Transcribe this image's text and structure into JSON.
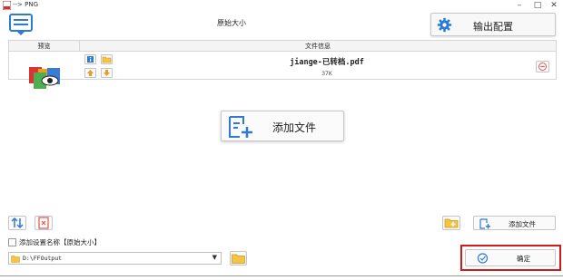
{
  "window": {
    "title": "--> PNG"
  },
  "toolbar": {
    "size_label": "原始大小",
    "output_config_label": "输出配置"
  },
  "table": {
    "headers": {
      "preview": "预览",
      "info": "文件信息"
    },
    "rows": [
      {
        "filename": "jiange-已转档.pdf",
        "size": "37K"
      }
    ]
  },
  "center": {
    "add_file_label": "添加文件"
  },
  "bottom": {
    "add_file_label": "添加文件",
    "checkbox_label": "添加设置名称【原始大小】",
    "checkbox_checked": false,
    "output_path": "D:\\FFOutput",
    "confirm_label": "确定"
  },
  "colors": {
    "accent_blue": "#2e7bd6",
    "highlight_red": "#d11a1a",
    "folder_yellow": "#f5c542",
    "remove_red": "#e05555"
  }
}
